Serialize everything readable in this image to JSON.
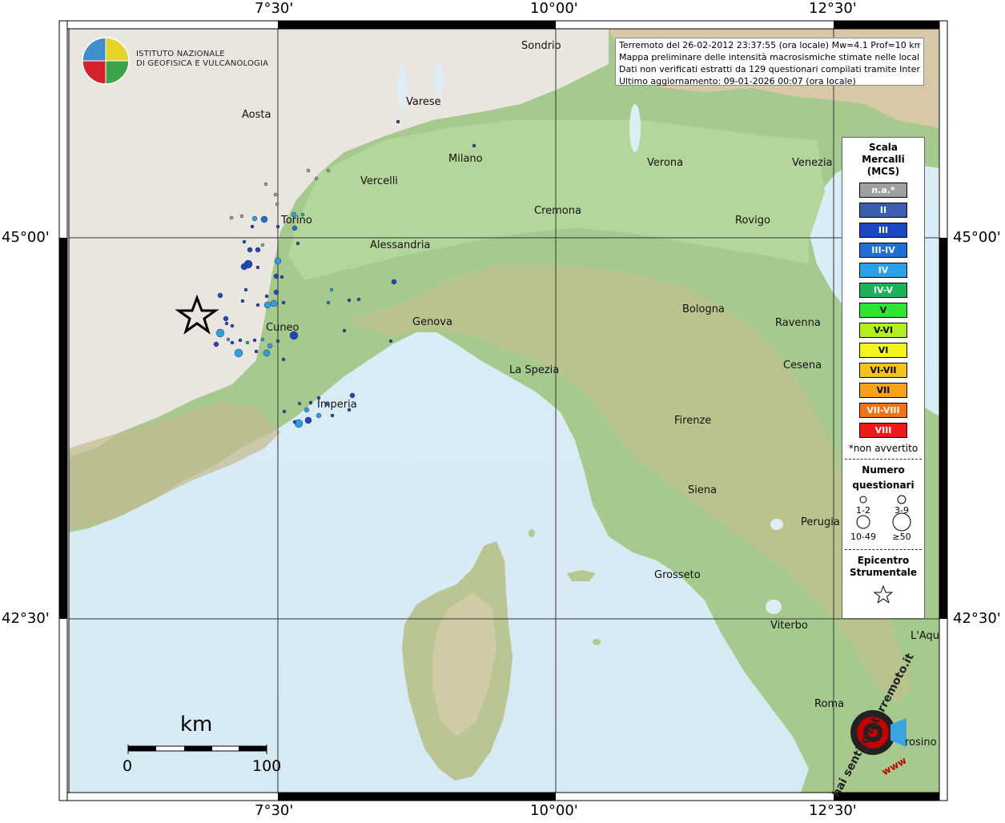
{
  "frame": {
    "top_labels": [
      "7°30'",
      "10°00'",
      "12°30'"
    ],
    "bottom_labels": [
      "7°30'",
      "10°00'",
      "12°30'"
    ],
    "left_labels": [
      "45°00'",
      "42°30'"
    ],
    "right_labels": [
      "45°00'",
      "42°30'"
    ]
  },
  "info": {
    "line1": "Terremoto del 26-02-2012 23:37:55 (ora locale) Mw=4.1 Prof=10 km",
    "line2": "Mappa preliminare delle intensità macrosismiche stimate nelle località",
    "line3": "Dati non verificati estratti da 129 questionari compilati tramite Internet.",
    "line4": "Ultimo aggiornamento: 09-01-2026 00:07 (ora locale)"
  },
  "logo": {
    "line1": "ISTITUTO NAZIONALE",
    "line2": "DI GEOFISICA E VULCANOLOGIA"
  },
  "cities": [
    {
      "name": "Sondrio"
    },
    {
      "name": "Aosta"
    },
    {
      "name": "Varese"
    },
    {
      "name": "Milano"
    },
    {
      "name": "Vercelli"
    },
    {
      "name": "Verona"
    },
    {
      "name": "Venezia"
    },
    {
      "name": "Torino"
    },
    {
      "name": "Cremona"
    },
    {
      "name": "Rovigo"
    },
    {
      "name": "Alessandria"
    },
    {
      "name": "Bologna"
    },
    {
      "name": "Cuneo"
    },
    {
      "name": "Genova"
    },
    {
      "name": "Ravenna"
    },
    {
      "name": "Cesena"
    },
    {
      "name": "La Spezia"
    },
    {
      "name": "Imperia"
    },
    {
      "name": "Firenze"
    },
    {
      "name": "Siena"
    },
    {
      "name": "Perugia"
    },
    {
      "name": "Grosseto"
    },
    {
      "name": "Viterbo"
    },
    {
      "name": "L'Aqu"
    },
    {
      "name": "Roma"
    },
    {
      "name": "rosino"
    }
  ],
  "legend": {
    "title1": "Scala",
    "title2": "Mercalli",
    "title3": "(MCS)",
    "classes": [
      {
        "label": "n.a.*",
        "color": "#a0a0a0"
      },
      {
        "label": "II",
        "color": "#3b5dae"
      },
      {
        "label": "III",
        "color": "#1b47c2"
      },
      {
        "label": "III-IV",
        "color": "#1f6fd6"
      },
      {
        "label": "IV",
        "color": "#2aa0e6"
      },
      {
        "label": "IV-V",
        "color": "#1cb25a"
      },
      {
        "label": "V",
        "color": "#2ee52e"
      },
      {
        "label": "V-VI",
        "color": "#b2f01c"
      },
      {
        "label": "VI",
        "color": "#f5f51a"
      },
      {
        "label": "VI-VII",
        "color": "#f5c21a"
      },
      {
        "label": "VII",
        "color": "#f5a21a"
      },
      {
        "label": "VII-VIII",
        "color": "#f27314"
      },
      {
        "label": "VIII",
        "color": "#ee1a1a"
      }
    ],
    "note": "*non avvertito",
    "count_title1": "Numero",
    "count_title2": "questionari",
    "sizes": [
      "1-2",
      "3-9",
      "10-49",
      "≥50"
    ],
    "epi_title1": "Epicentro",
    "epi_title2": "Strumentale"
  },
  "scalebar": {
    "unit": "km",
    "start": "0",
    "end": "100"
  },
  "hsh": {
    "text": "hai sentito il terremoto.it",
    "url_text": "www"
  }
}
